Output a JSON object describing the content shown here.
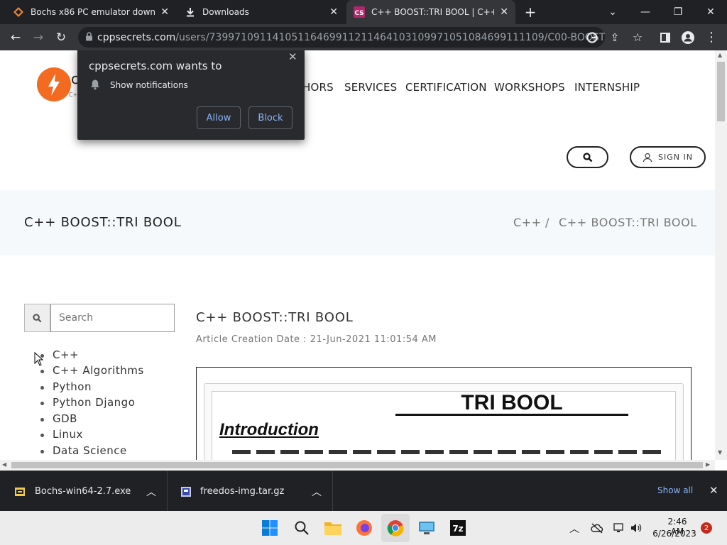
{
  "tabs": [
    {
      "title": "Bochs x86 PC emulator download",
      "icon": "bochs-favicon"
    },
    {
      "title": "Downloads",
      "icon": "download-icon"
    },
    {
      "title": "C++ BOOST::TRI BOOL | C++ | cppsecrets.com",
      "icon": "cs-favicon"
    }
  ],
  "address": {
    "host": "cppsecrets.com",
    "path": "/users/73997109114105116469911211464103109971051084699111109/C00-BOOSTTRI-BO..."
  },
  "popup": {
    "title": "cppsecrets.com wants to",
    "item": "Show notifications",
    "allow": "Allow",
    "block": "Block"
  },
  "site": {
    "nav_partial": "HORS",
    "nav": [
      "SERVICES",
      "CERTIFICATION",
      "WORKSHOPS",
      "INTERNSHIP"
    ],
    "sign_in": "SIGN IN",
    "logo_partial_1": "c",
    "logo_partial_2": "C+"
  },
  "header": {
    "title": "C++ BOOST::TRI BOOL",
    "crumb_1": "C++",
    "crumb_sep": "/",
    "crumb_2": "C++ BOOST::TRI BOOL"
  },
  "sidebar": {
    "search_placeholder": "Search",
    "items": [
      "C++",
      "C++ Algorithms",
      "Python",
      "Python Django",
      "GDB",
      "Linux",
      "Data Science"
    ]
  },
  "article": {
    "title": "C++ BOOST::TRI BOOL",
    "date": "Article Creation Date : 21-Jun-2021 11:01:54 AM",
    "heading": "TRI BOOL",
    "section": "Introduction"
  },
  "downloads": {
    "items": [
      {
        "name": "Bochs-win64-2.7.exe"
      },
      {
        "name": "freedos-img.tar.gz"
      }
    ],
    "show_all": "Show all"
  },
  "taskbar": {
    "time": "2:46 AM",
    "date": "6/26/2023",
    "notif_count": "2"
  },
  "colors": {
    "logo_orange": "#f26b21",
    "popup_link": "#8ab4f8",
    "chrome_dark": "#202124"
  }
}
